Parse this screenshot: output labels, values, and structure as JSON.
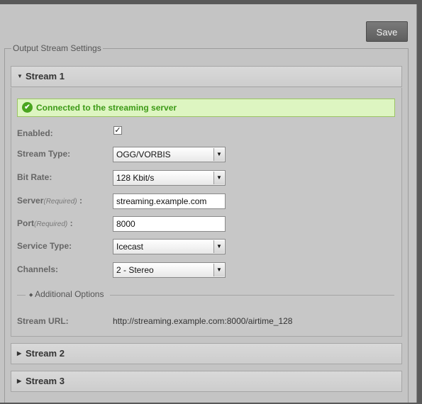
{
  "toolbar": {
    "save_label": "Save"
  },
  "settings": {
    "legend": "Output Stream Settings",
    "streams": [
      {
        "title": "Stream 1",
        "expanded": true
      },
      {
        "title": "Stream 2",
        "expanded": false
      },
      {
        "title": "Stream 3",
        "expanded": false
      }
    ],
    "notice": "Connected to the streaming server",
    "fields": {
      "enabled": {
        "label": "Enabled:",
        "checked": true,
        "check_glyph": "✓"
      },
      "stream_type": {
        "label": "Stream Type:",
        "value": "OGG/VORBIS"
      },
      "bit_rate": {
        "label": "Bit Rate:",
        "value": "128 Kbit/s"
      },
      "server": {
        "label": "Server",
        "required": "(Required)",
        "suffix": " :",
        "value": "streaming.example.com"
      },
      "port": {
        "label": "Port",
        "required": "(Required)",
        "suffix": " :",
        "value": "8000"
      },
      "service_type": {
        "label": "Service Type:",
        "value": "Icecast"
      },
      "channels": {
        "label": "Channels:",
        "value": "2 - Stereo"
      }
    },
    "additional_options": "Additional Options",
    "stream_url": {
      "label": "Stream URL:",
      "value": "http://streaming.example.com:8000/airtime_128"
    }
  },
  "icons": {
    "expanded": "▼",
    "collapsed": "▶",
    "toggle": "◆",
    "select_arrow": "▼",
    "success": "✔"
  },
  "colors": {
    "success_text": "#3c9a16",
    "success_bg": "#ddf5c1",
    "button_bg": "#6b6b6b"
  }
}
